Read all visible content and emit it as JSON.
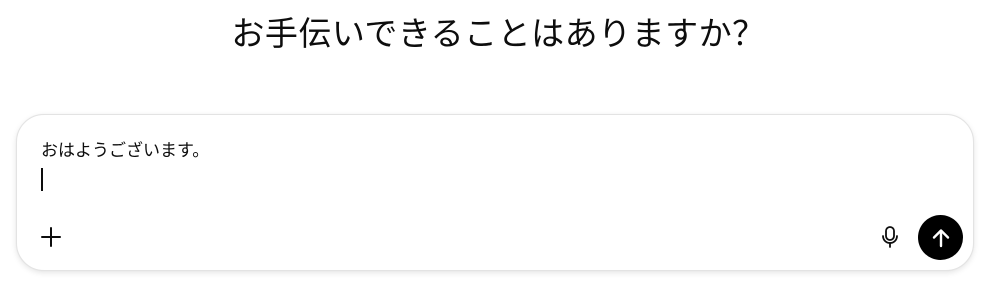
{
  "heading": "お手伝いできることはありますか？",
  "composer": {
    "input_value": "おはようございます。"
  },
  "icons": {
    "plus": "plus-icon",
    "microphone": "microphone-icon",
    "send": "arrow-up-icon"
  },
  "colors": {
    "send_button_bg": "#000000",
    "border": "#e3e3e3",
    "text": "#0d0d0d"
  }
}
